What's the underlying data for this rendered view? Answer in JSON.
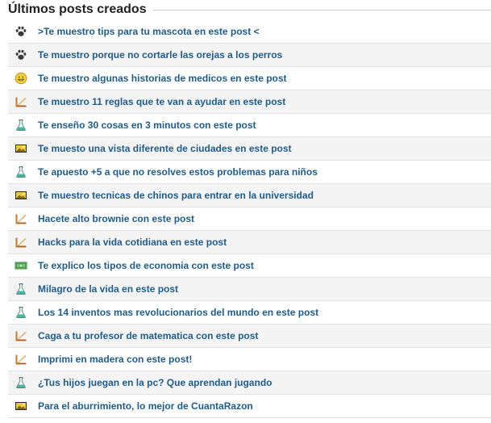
{
  "header": {
    "title": "Últimos posts creados"
  },
  "posts": [
    {
      "category_icon": "paw-icon",
      "title": ">Te muestro tips para tu mascota en este post <"
    },
    {
      "category_icon": "paw-icon",
      "title": "Te muestro porque no cortarle las orejas a los perros"
    },
    {
      "category_icon": "smiley-icon",
      "title": "Te muestro algunas historias de medicos en este post"
    },
    {
      "category_icon": "ruler-icon",
      "title": "Te muestro 11 reglas que te van a ayudar en este post"
    },
    {
      "category_icon": "flask-icon",
      "title": "Te enseño 30 cosas en 3 minutos con este post"
    },
    {
      "category_icon": "photo-icon",
      "title": "Te muesto una vista diferente de ciudades en este post"
    },
    {
      "category_icon": "flask-icon",
      "title": "Te apuesto +5 a que no resolves estos problemas para niños"
    },
    {
      "category_icon": "photo-icon",
      "title": "Te muestro tecnicas de chinos para entrar en la universidad"
    },
    {
      "category_icon": "ruler-icon",
      "title": "Hacete alto brownie con este post"
    },
    {
      "category_icon": "ruler-icon",
      "title": "Hacks para la vida cotidiana en este post"
    },
    {
      "category_icon": "money-icon",
      "title": "Te explico los tipos de economia con este post"
    },
    {
      "category_icon": "flask-icon",
      "title": "Milagro de la vida en este post"
    },
    {
      "category_icon": "flask-icon",
      "title": "Los 14 inventos mas revolucionarios del mundo en este post"
    },
    {
      "category_icon": "ruler-icon",
      "title": "Caga a tu profesor de matematica con este post"
    },
    {
      "category_icon": "ruler-icon",
      "title": "Imprimi en madera con este post!"
    },
    {
      "category_icon": "flask-icon",
      "title": "¿Tus hijos juegan en la pc? Que aprendan jugando"
    },
    {
      "category_icon": "photo-icon",
      "title": "Para el aburrimiento, lo mejor de CuantaRazon"
    }
  ],
  "colors": {
    "link": "#1f5c8a",
    "title": "#222222",
    "row_alt": "#f4f4f4",
    "divider": "#e3e3e3"
  }
}
